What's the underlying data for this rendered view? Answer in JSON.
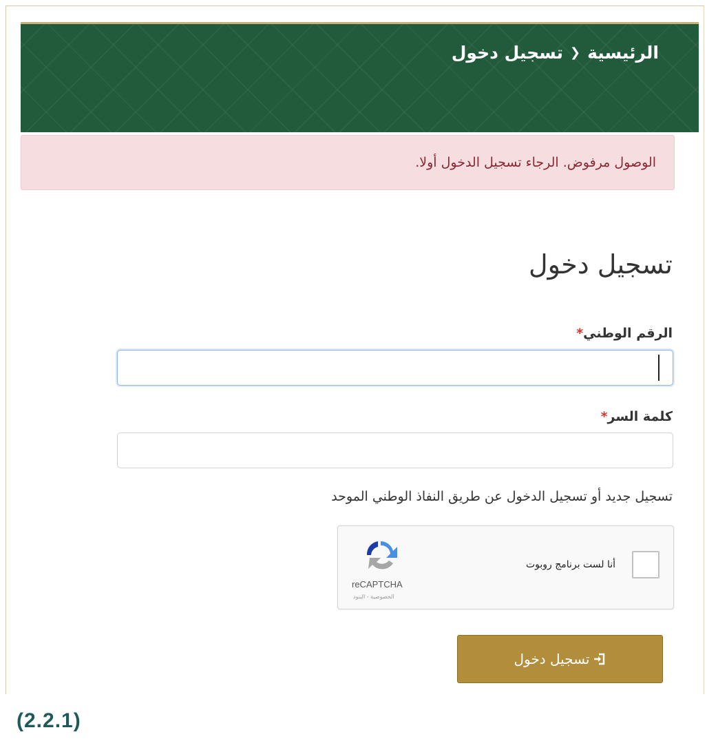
{
  "breadcrumb": {
    "home": "الرئيسية",
    "separator_icon": "chevron-left-icon",
    "current": "تسجيل دخول"
  },
  "alert": {
    "message": "الوصول مرفوض. الرجاء تسجيل الدخول أولا."
  },
  "form": {
    "title": "تسجيل دخول",
    "national_id": {
      "label": "الرقم الوطني",
      "required_mark": "*",
      "value": ""
    },
    "password": {
      "label": "كلمة السر",
      "required_mark": "*",
      "value": ""
    },
    "nafath_link": "تسجيل جديد أو تسجيل الدخول عن طريق النفاذ الوطني الموحد",
    "recaptcha": {
      "label": "أنا لست برنامج روبوت",
      "brand": "reCAPTCHA",
      "terms": "الخصوصية - البنود",
      "checked": false
    },
    "submit": {
      "label": "تسجيل دخول",
      "icon": "sign-in-icon"
    }
  },
  "caption": "(2.2.1)",
  "colors": {
    "header": "#225a3c",
    "header_accent": "#c9b27a",
    "alert_bg": "#f6dde0",
    "alert_text": "#8b2734",
    "required": "#d9342b",
    "button": "#b28d3c",
    "caption": "#1f5a58"
  }
}
